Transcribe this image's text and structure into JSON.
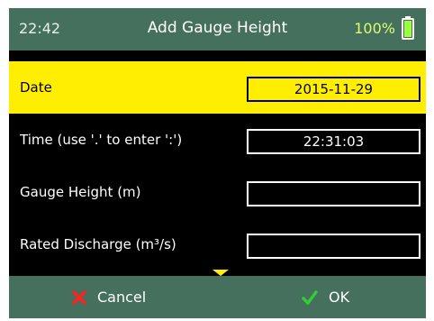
{
  "header": {
    "time": "22:42",
    "title": "Add Gauge Height",
    "battery_text": "100%",
    "battery_color": "#9cff3a",
    "background": "#45705e"
  },
  "form": {
    "rows": [
      {
        "label": "Date",
        "value": "2015-11-29",
        "selected": true
      },
      {
        "label": "Time (use '.' to enter ':')",
        "value": "22:31:03",
        "selected": false
      },
      {
        "label": "Gauge Height (m)",
        "value": "",
        "selected": false
      },
      {
        "label": "Rated Discharge (m³/s)",
        "value": "",
        "selected": false
      }
    ],
    "highlight_color": "#ffee00"
  },
  "footer": {
    "cancel_label": "Cancel",
    "cancel_icon": "x-icon",
    "cancel_icon_color": "#ff2020",
    "ok_label": "OK",
    "ok_icon": "checkmark-icon",
    "ok_icon_color": "#33cc33"
  }
}
